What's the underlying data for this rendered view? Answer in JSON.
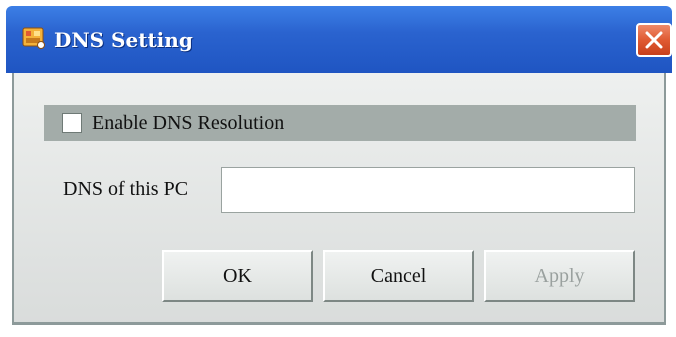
{
  "window": {
    "title": "DNS Setting",
    "icon": "app-icon",
    "close_icon": "close-icon",
    "accent_color": "#2a63cf",
    "close_color": "#e05a32"
  },
  "settings": {
    "enable_label": "Enable DNS Resolution",
    "enable_checked": false,
    "dns_label": "DNS of this PC",
    "dns_value": ""
  },
  "buttons": {
    "ok": "OK",
    "cancel": "Cancel",
    "apply": "Apply"
  }
}
